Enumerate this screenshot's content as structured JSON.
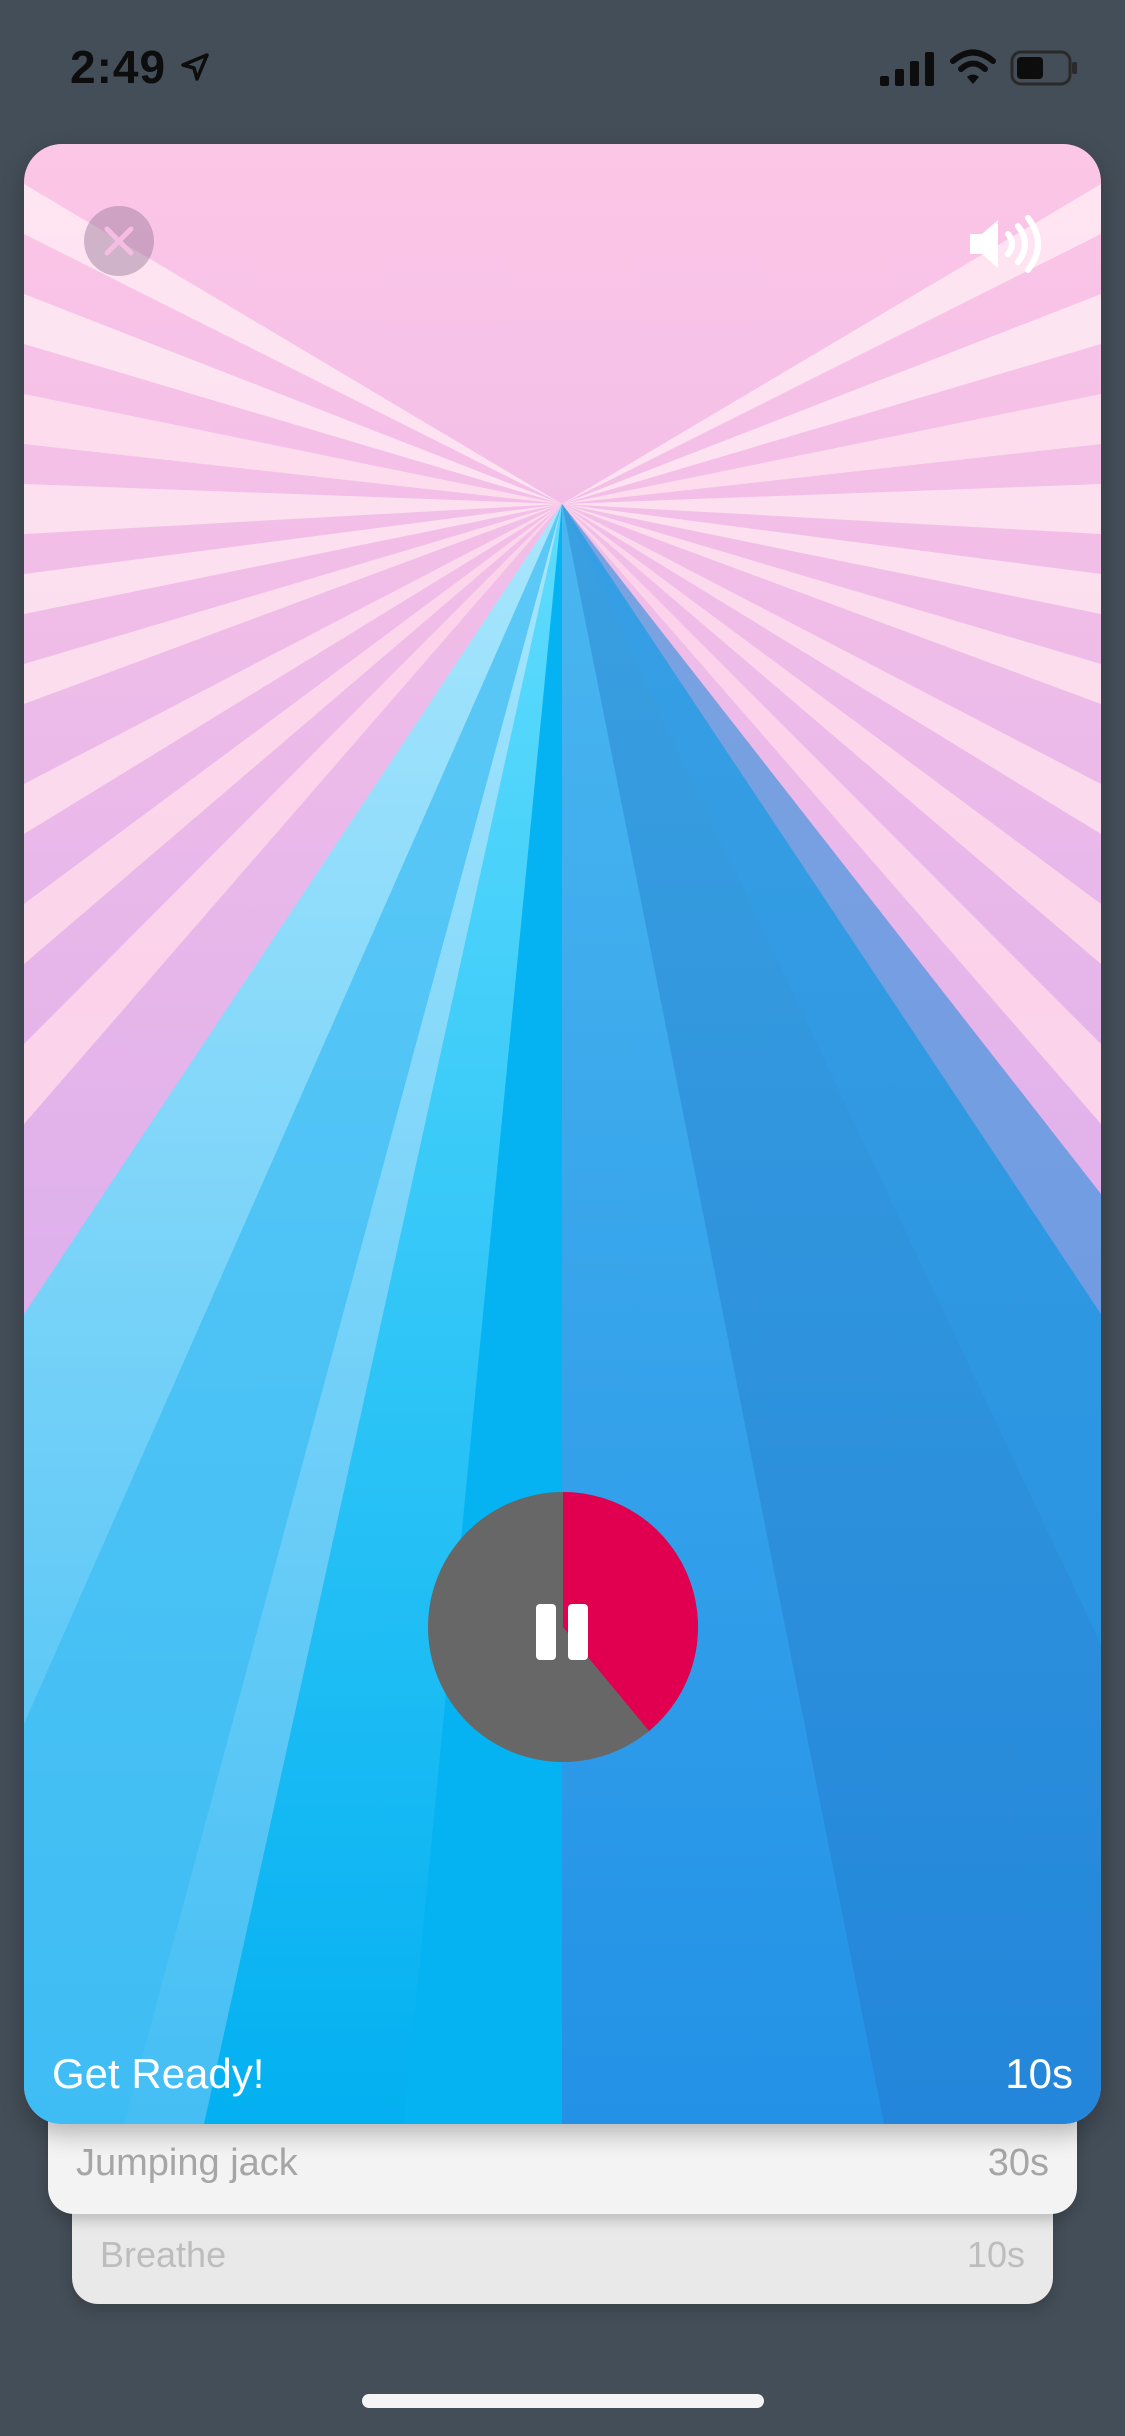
{
  "status_bar": {
    "time": "2:49",
    "icons": [
      "location-arrow-icon",
      "cellular-signal-icon",
      "wifi-icon",
      "battery-icon"
    ]
  },
  "player": {
    "controls": {
      "close_icon": "close-icon",
      "sound_icon": "speaker-volume-icon",
      "pause_icon": "pause-icon"
    },
    "current_phase": {
      "label": "Get Ready!",
      "duration": "10s"
    },
    "timer_progress": 0.39,
    "colors": {
      "sky_top": "#fcc6e6",
      "sky_bottom": "#c8a0f0",
      "road_light": "#7fd8fb",
      "road_center": "#06b4f2",
      "road_right": "#2a8fdc",
      "timer_track": "#676767",
      "timer_progress": "#e0004f"
    }
  },
  "queue": [
    {
      "label": "Jumping jack",
      "duration": "30s"
    },
    {
      "label": "Breathe",
      "duration": "10s"
    }
  ]
}
